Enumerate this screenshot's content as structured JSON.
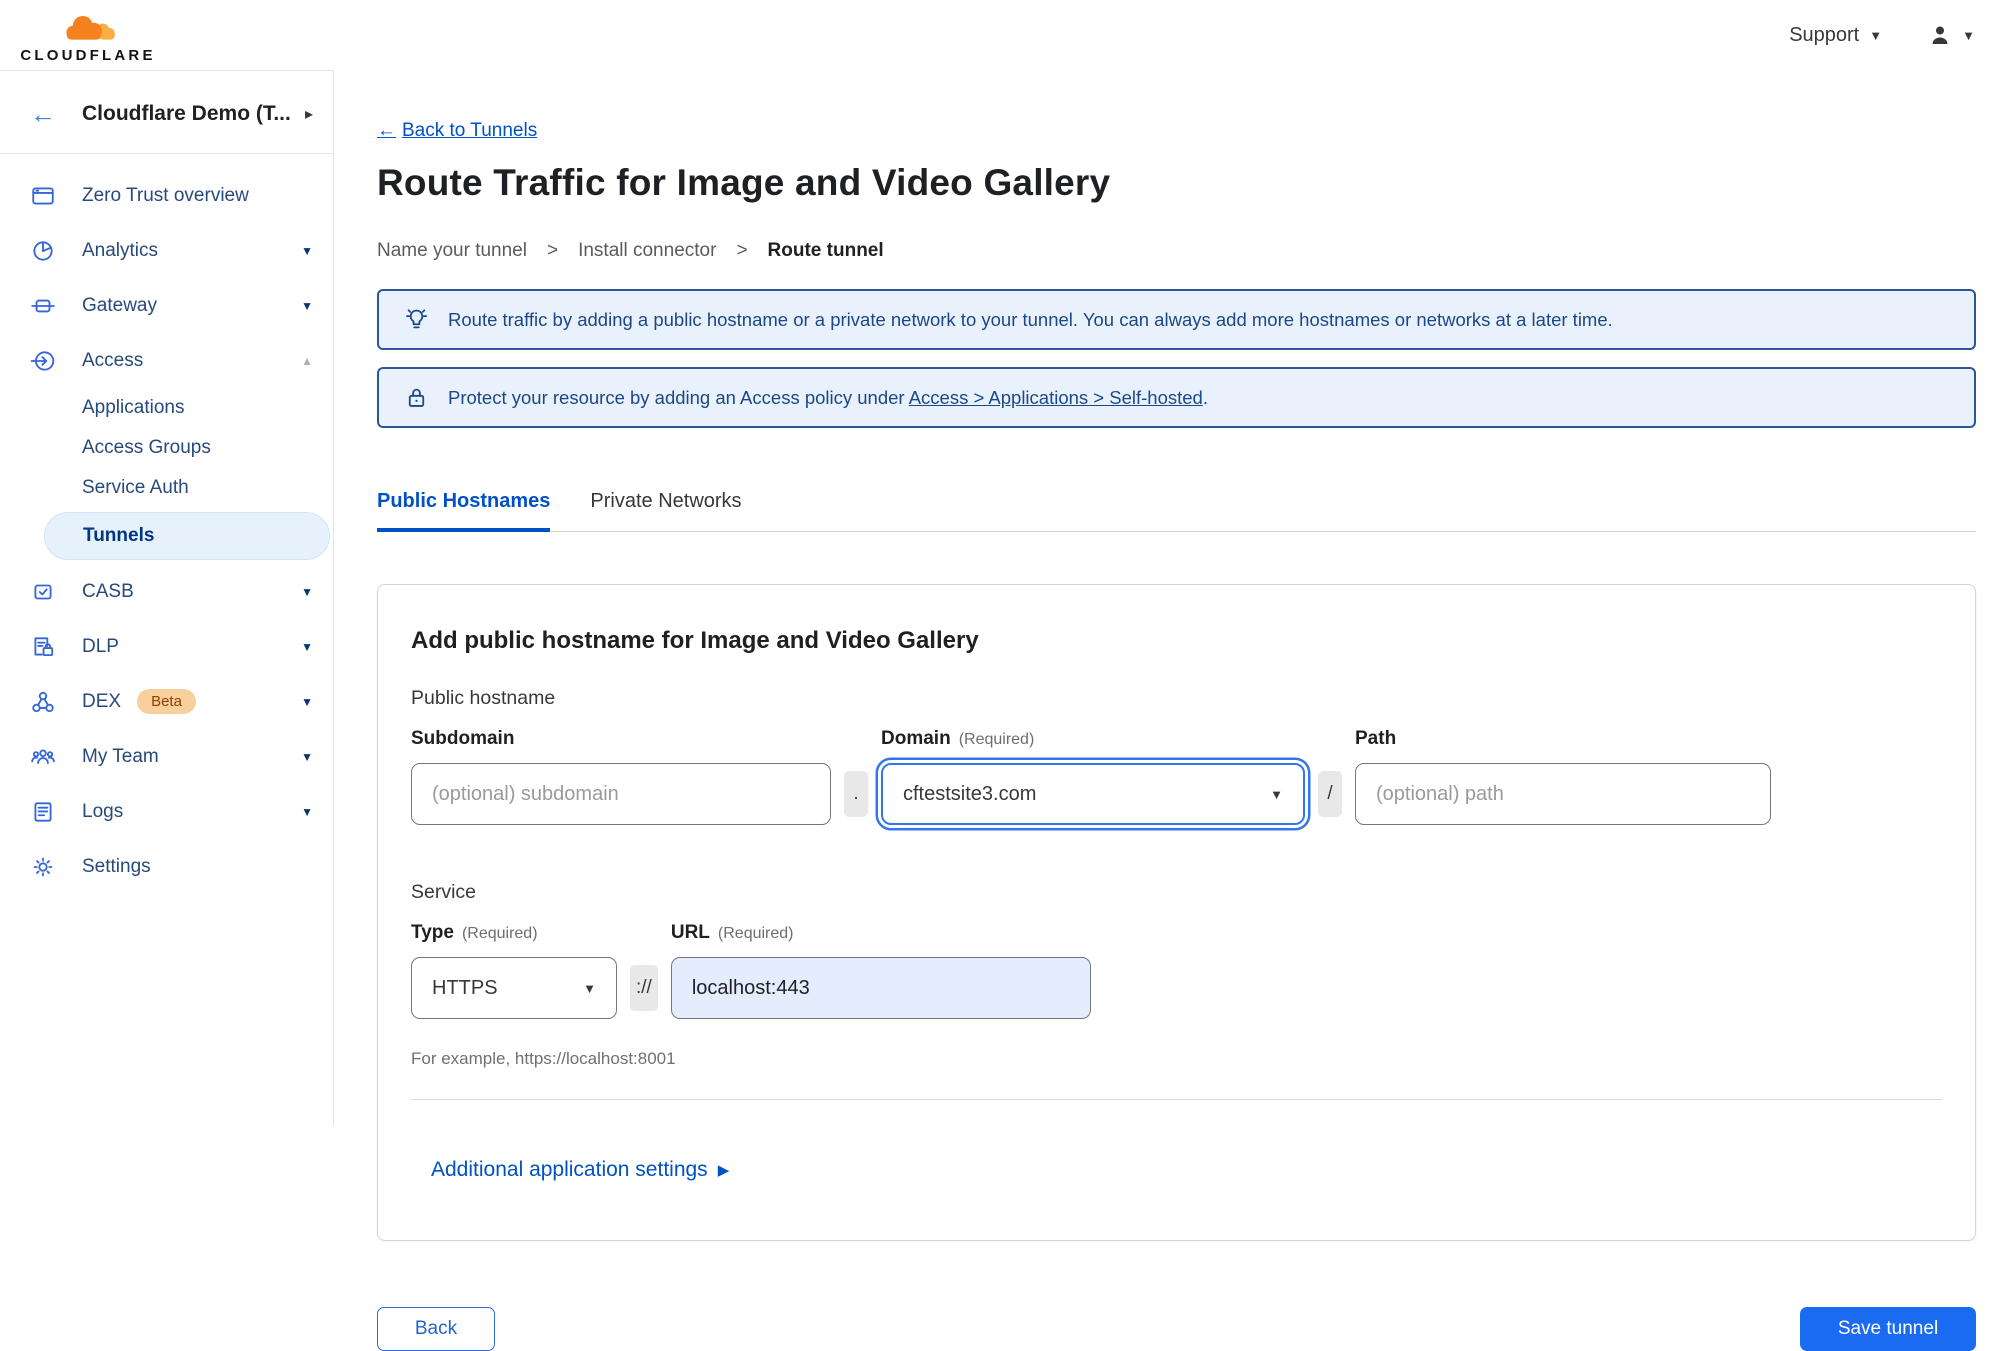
{
  "brand": {
    "name": "CLOUDFLARE"
  },
  "topbar": {
    "support_label": "Support"
  },
  "icons": {
    "back_arrow": "←",
    "forward_chevron": "▸",
    "chevron_down": "▼",
    "chevron_up": "▲",
    "breadcrumb_separator": ">",
    "settings_arrow": "▶"
  },
  "sidebar": {
    "account_label": "Cloudflare Demo (T...",
    "overview": "Zero Trust overview",
    "analytics": "Analytics",
    "gateway": "Gateway",
    "access": "Access",
    "applications": "Applications",
    "access_groups": "Access Groups",
    "service_auth": "Service Auth",
    "tunnels": "Tunnels",
    "casb": "CASB",
    "dlp": "DLP",
    "dex": "DEX",
    "dex_badge": "Beta",
    "my_team": "My Team",
    "logs": "Logs",
    "settings": "Settings"
  },
  "main": {
    "back_link_label": "Back to Tunnels",
    "title": "Route Traffic for Image and Video Gallery",
    "breadcrumb": {
      "step1": "Name your tunnel",
      "step2": "Install connector",
      "step3": "Route tunnel"
    },
    "banners": {
      "info": "Route traffic by adding a public hostname or a private network to your tunnel. You can always add more hostnames or networks at a later time.",
      "protect_prefix": "Protect your resource by adding an Access policy under",
      "protect_link": "Access > Applications > Self-hosted",
      "protect_suffix": "."
    },
    "tabs": {
      "public_hostnames": "Public Hostnames",
      "private_networks": "Private Networks"
    },
    "form": {
      "heading": "Add public hostname for Image and Video Gallery",
      "section_public_hostname": "Public hostname",
      "subdomain_label": "Subdomain",
      "subdomain_placeholder": "(optional) subdomain",
      "dot_separator": ".",
      "domain_label": "Domain",
      "required_label": "(Required)",
      "domain_value": "cftestsite3.com",
      "slash_separator": "/",
      "path_label": "Path",
      "path_placeholder": "(optional) path",
      "section_service": "Service",
      "type_label": "Type",
      "type_value": "HTTPS",
      "scheme_separator": "://",
      "url_label": "URL",
      "url_value": "localhost:443",
      "example": "For example, https://localhost:8001",
      "additional_settings": "Additional application settings"
    },
    "footer": {
      "back": "Back",
      "save": "Save tunnel"
    }
  }
}
